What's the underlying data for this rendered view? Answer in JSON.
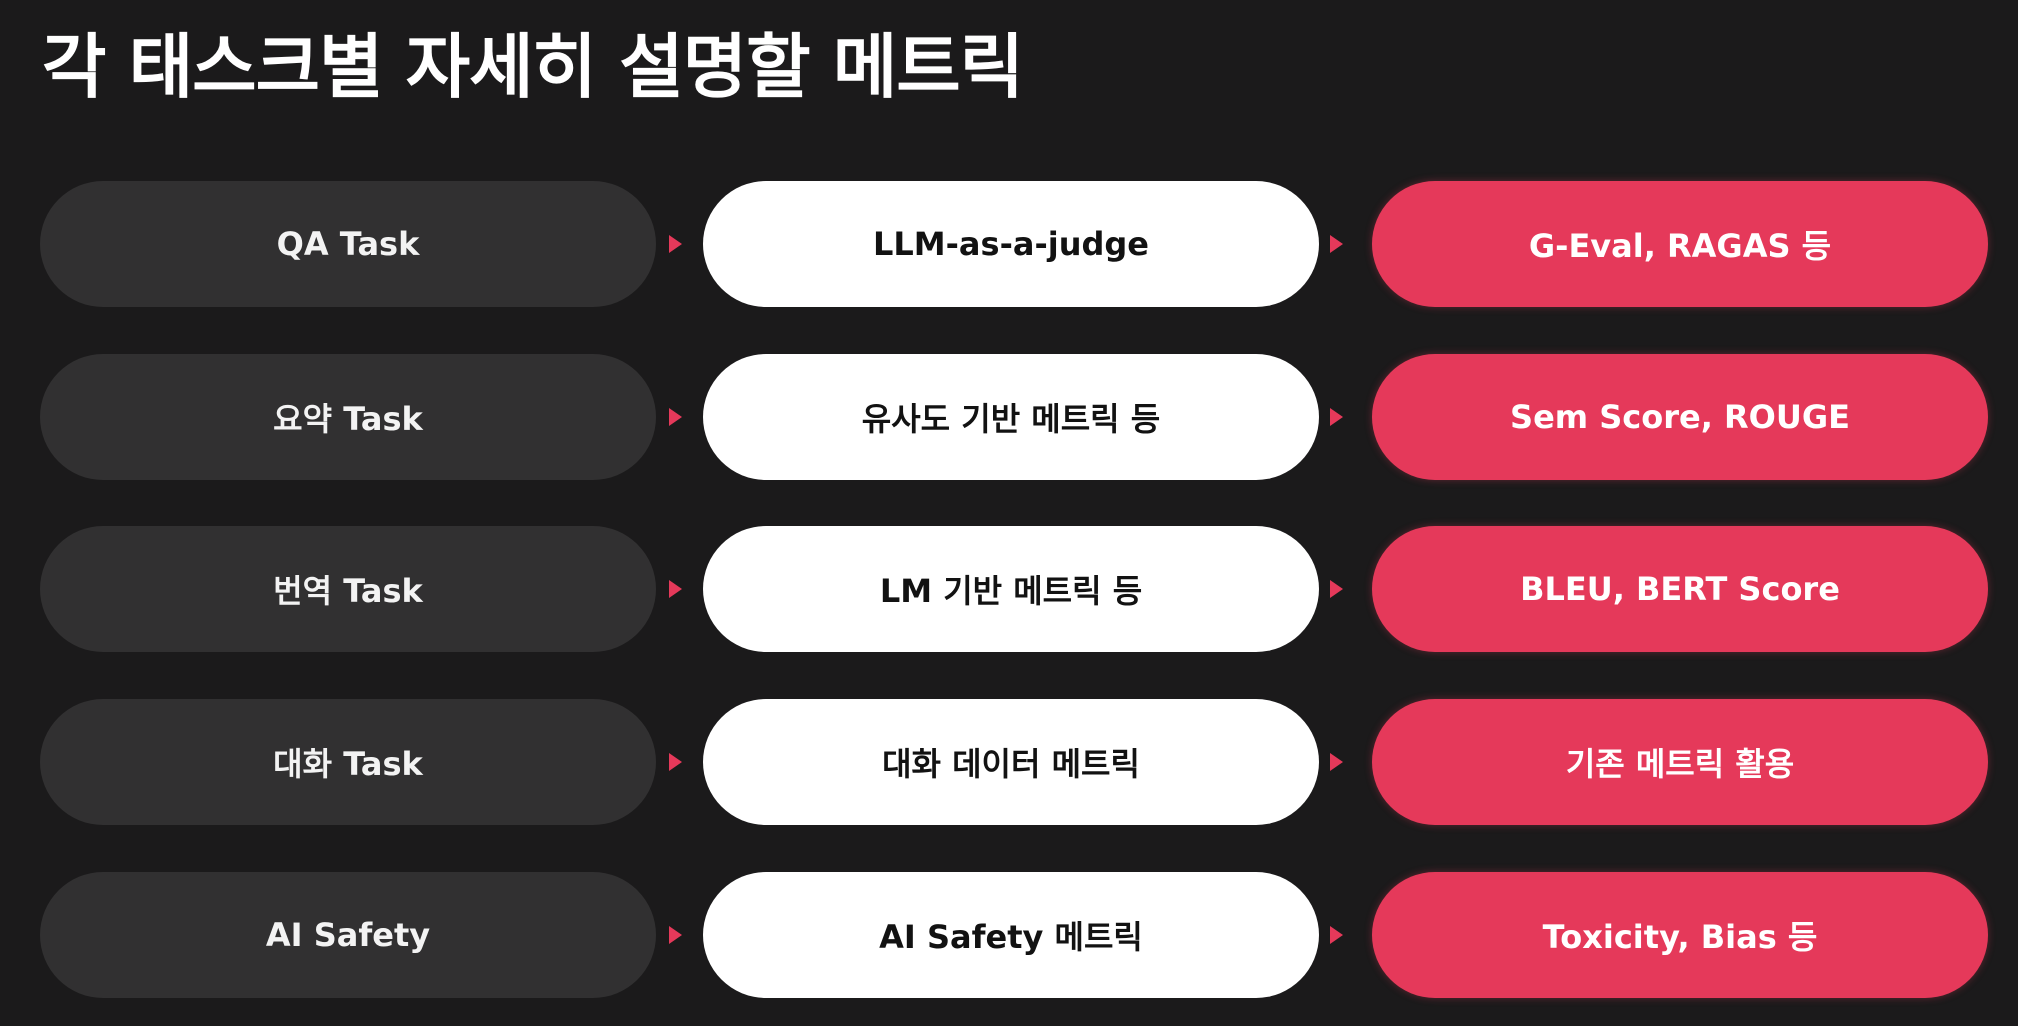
{
  "slide": {
    "title": "각 태스크별 자세히 설명할 메트릭"
  },
  "colors": {
    "background": "#1b1a1b",
    "task_pill": "#313031",
    "method_pill": "#ffffff",
    "metric_pill": "#e5395a",
    "arrow": "#e5395a"
  },
  "rows": [
    {
      "task": "QA Task",
      "method": "LLM-as-a-judge",
      "metric": "G-Eval, RAGAS 등"
    },
    {
      "task": "요약 Task",
      "method": "유사도 기반 메트릭 등",
      "metric": "Sem Score, ROUGE"
    },
    {
      "task": "번역 Task",
      "method": "LM 기반 메트릭 등",
      "metric": "BLEU, BERT Score"
    },
    {
      "task": "대화 Task",
      "method": "대화 데이터 메트릭",
      "metric": "기존 메트릭 활용"
    },
    {
      "task": "AI Safety",
      "method": "AI Safety 메트릭",
      "metric": "Toxicity, Bias 등"
    }
  ]
}
